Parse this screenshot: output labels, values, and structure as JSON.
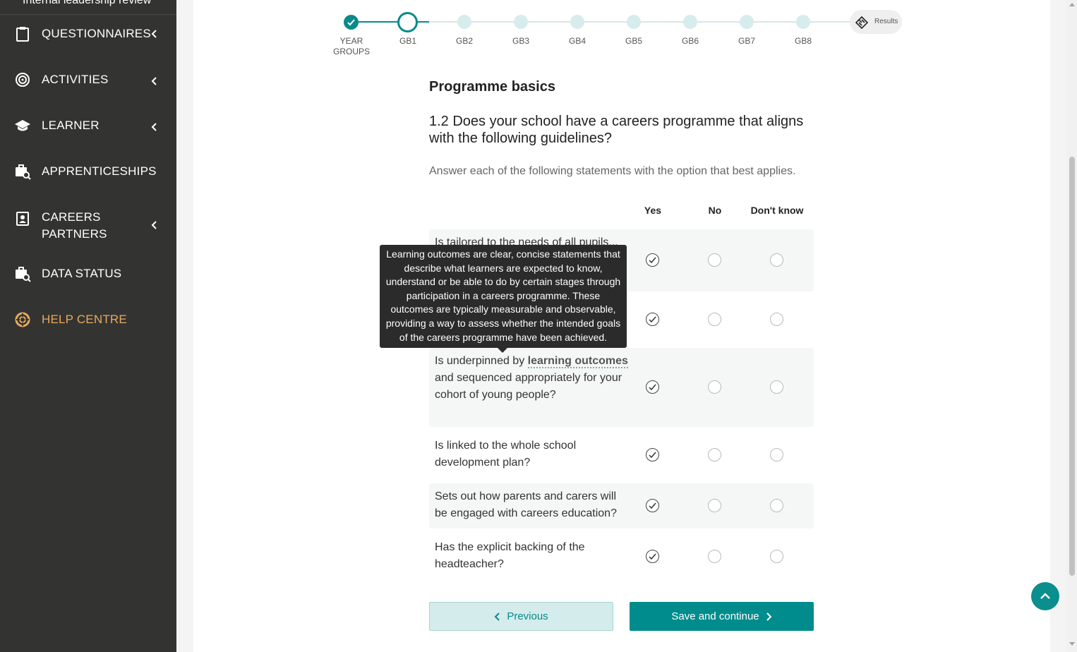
{
  "sidebar": {
    "top_label": "Internal leadership review",
    "items": [
      {
        "label": "QUESTIONNAIRES",
        "icon": "clipboard-icon",
        "has_chevron": true
      },
      {
        "label": "ACTIVITIES",
        "icon": "target-icon",
        "has_chevron": true
      },
      {
        "label": "LEARNER",
        "icon": "graduation-cap-icon",
        "has_chevron": true
      },
      {
        "label": "APPRENTICESHIPS",
        "icon": "briefcase-search-icon",
        "has_chevron": false
      },
      {
        "label": "CAREERS",
        "label2": "PARTNERS",
        "icon": "contact-card-icon",
        "has_chevron": true
      },
      {
        "label": "DATA STATUS",
        "icon": "briefcase-search-icon",
        "has_chevron": false
      },
      {
        "label": "HELP CENTRE",
        "icon": "lifebuoy-icon",
        "has_chevron": false
      }
    ]
  },
  "stepper": {
    "steps": [
      {
        "label": "YEAR",
        "label2": "GROUPS",
        "state": "complete"
      },
      {
        "label": "GB1",
        "state": "current"
      },
      {
        "label": "GB2",
        "state": "upcoming"
      },
      {
        "label": "GB3",
        "state": "upcoming"
      },
      {
        "label": "GB4",
        "state": "upcoming"
      },
      {
        "label": "GB5",
        "state": "upcoming"
      },
      {
        "label": "GB6",
        "state": "upcoming"
      },
      {
        "label": "GB7",
        "state": "upcoming"
      },
      {
        "label": "GB8",
        "state": "upcoming"
      }
    ],
    "results_label": "Results"
  },
  "section_title": "Programme basics",
  "question": "1.2 Does your school have a careers programme that aligns with the following guidelines?",
  "hint": "Answer each of the following statements with the option that best applies.",
  "columns": [
    "Yes",
    "No",
    "Don't know"
  ],
  "rows": [
    {
      "text": "Is tailored to the needs of all pupils...",
      "answer": "Yes"
    },
    {
      "text": "",
      "answer": "Yes"
    },
    {
      "text_before": "Is underpinned by ",
      "term": "learning outcomes",
      "text_after": " and sequenced appropriately for your cohort of young people?",
      "answer": "Yes"
    },
    {
      "text": "Is linked to the whole school development plan?",
      "answer": "Yes"
    },
    {
      "text": "Sets out how parents and carers will be engaged with careers education?",
      "answer": "Yes"
    },
    {
      "text": "Has the explicit backing of the headteacher?",
      "answer": "Yes"
    }
  ],
  "tooltip": "Learning outcomes are clear, concise statements that describe what learners are expected to know, understand or be able to do by certain stages through participation in a careers programme. These outcomes are typically measurable and observable, providing a way to assess whether the intended goals of the careers programme have been achieved.",
  "buttons": {
    "previous": "Previous",
    "save_continue": "Save and continue"
  },
  "colors": {
    "sidebar_bg": "#333432",
    "accent": "#008c8c",
    "help_centre": "#e8a95b"
  }
}
